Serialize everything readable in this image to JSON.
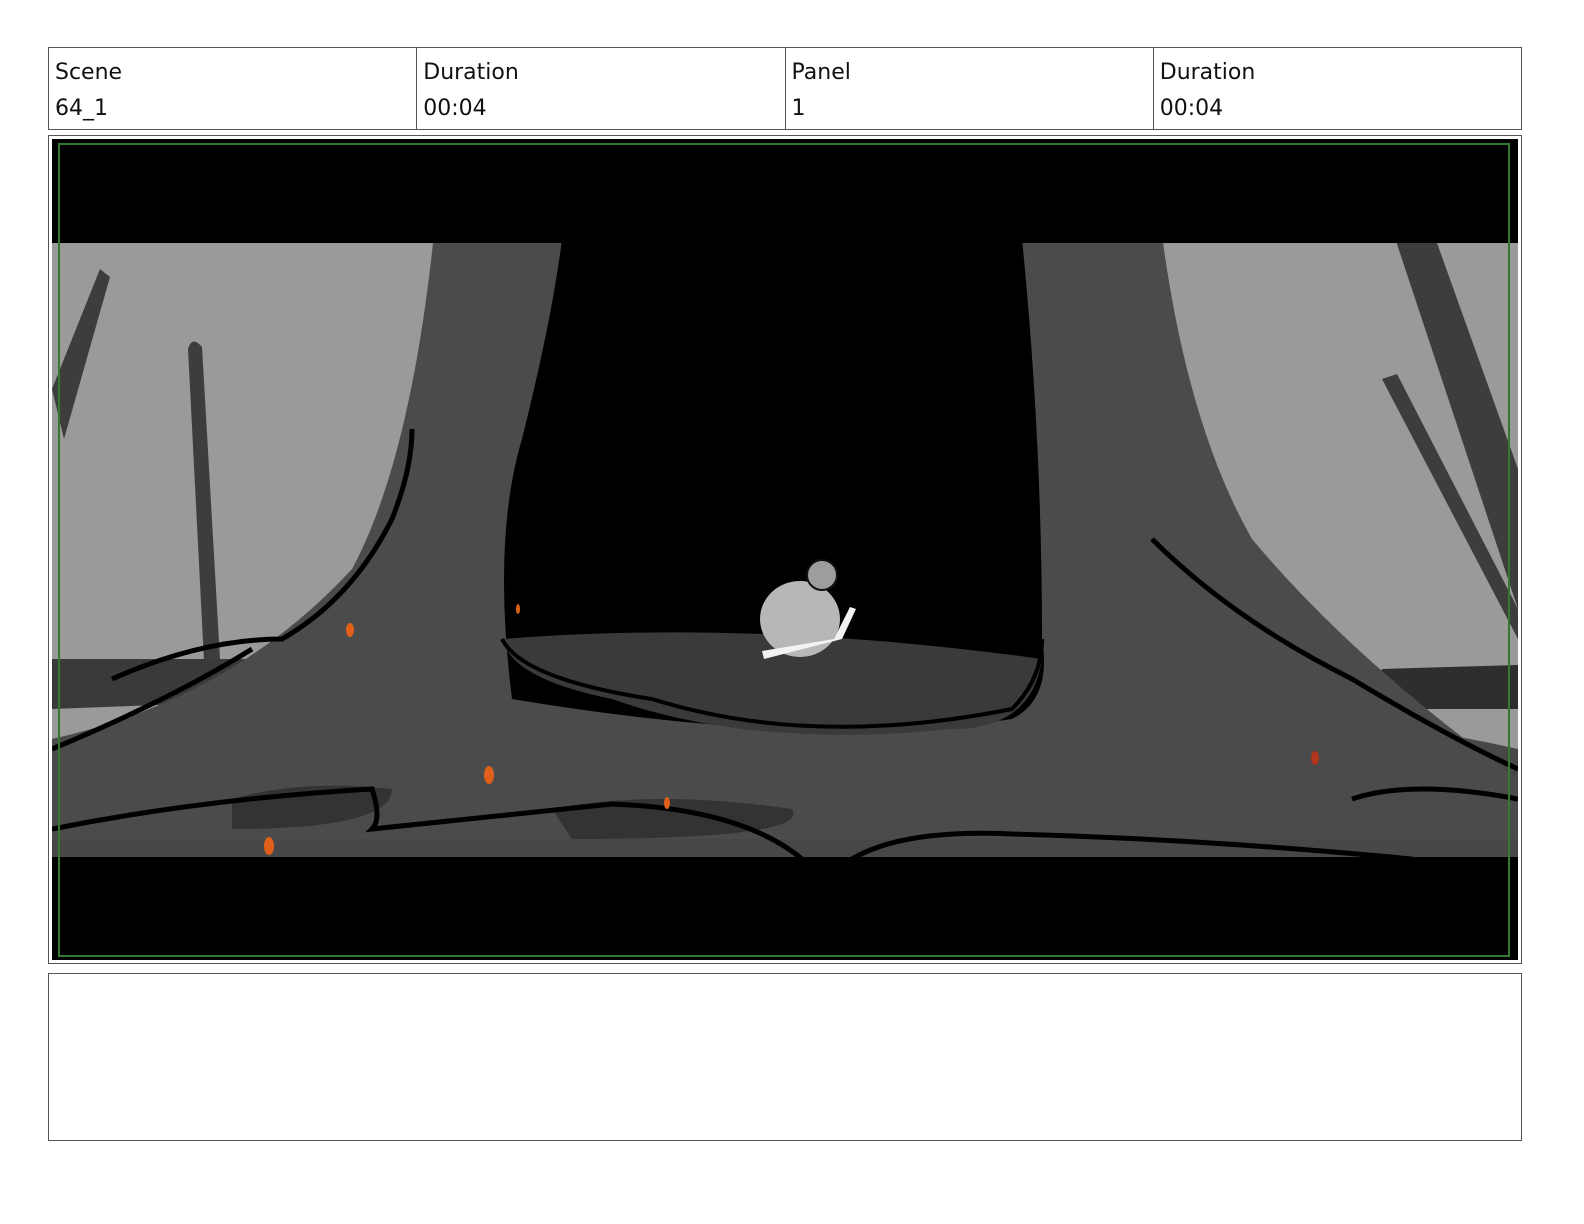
{
  "header": {
    "cells": [
      {
        "label": "Scene",
        "value": "64_1"
      },
      {
        "label": "Duration",
        "value": "00:04"
      },
      {
        "label": "Panel",
        "value": "1"
      },
      {
        "label": "Duration",
        "value": "00:04"
      }
    ]
  },
  "notes": {
    "text": ""
  },
  "colors": {
    "sky": "#9a9a9a",
    "far_trees": "#3d3d3d",
    "trunk": "#4b4b4b",
    "ground": "#474747",
    "shadow": "#333333",
    "cavity": "#000000",
    "letterbox": "#000000",
    "ember": "#e0601a",
    "safe_frame": "#2f7a2f"
  }
}
